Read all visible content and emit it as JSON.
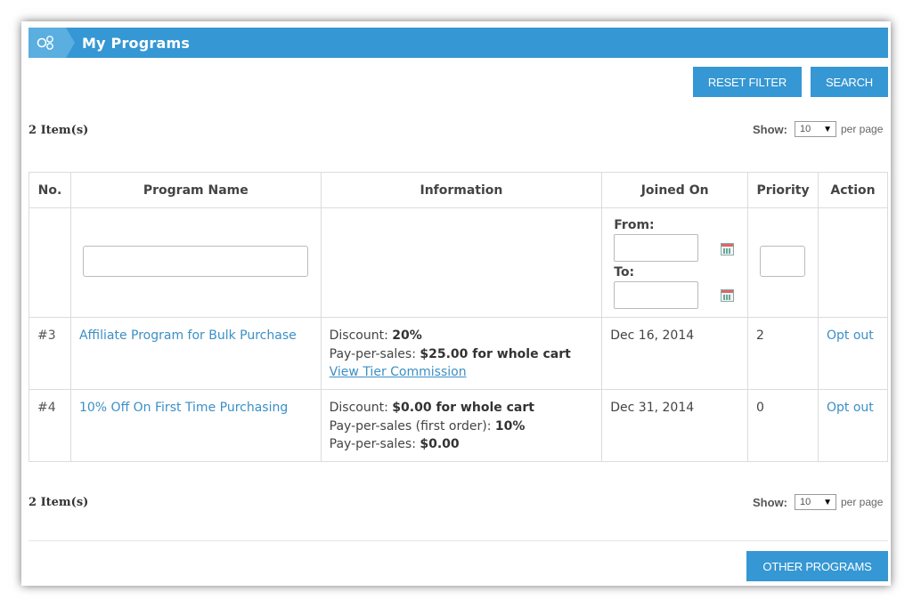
{
  "header": {
    "title": "My Programs",
    "icon": "programs-icon"
  },
  "toolbar": {
    "reset_label": "RESET FILTER",
    "search_label": "SEARCH"
  },
  "summary_top": {
    "count": "2 Item(s)",
    "show_label": "Show:",
    "per_page_value": "10",
    "per_page_suffix": "per page"
  },
  "summary_bottom": {
    "count": "2 Item(s)",
    "show_label": "Show:",
    "per_page_value": "10",
    "per_page_suffix": "per page"
  },
  "table": {
    "columns": [
      "No.",
      "Program Name",
      "Information",
      "Joined On",
      "Priority",
      "Action"
    ],
    "filters": {
      "from_label": "From:",
      "to_label": "To:"
    },
    "rows": [
      {
        "no": "#3",
        "name": "Affiliate Program for Bulk Purchase",
        "info": [
          {
            "label": "Discount: ",
            "value": "20%"
          },
          {
            "label": "Pay-per-sales: ",
            "value": "$25.00 for whole cart"
          }
        ],
        "info_link": "View Tier Commission",
        "joined": "Dec 16, 2014",
        "priority": "2",
        "action": "Opt out"
      },
      {
        "no": "#4",
        "name": "10% Off On First Time Purchasing",
        "info": [
          {
            "label": "Discount: ",
            "value": "$0.00 for whole cart"
          },
          {
            "label": "Pay-per-sales (first order): ",
            "value": "10%"
          },
          {
            "label": "Pay-per-sales: ",
            "value": "$0.00"
          }
        ],
        "joined": "Dec 31, 2014",
        "priority": "0",
        "action": "Opt out"
      }
    ]
  },
  "footer": {
    "other_programs_label": "OTHER PROGRAMS"
  },
  "colors": {
    "accent": "#3597d3",
    "link": "#3b8fc6"
  }
}
